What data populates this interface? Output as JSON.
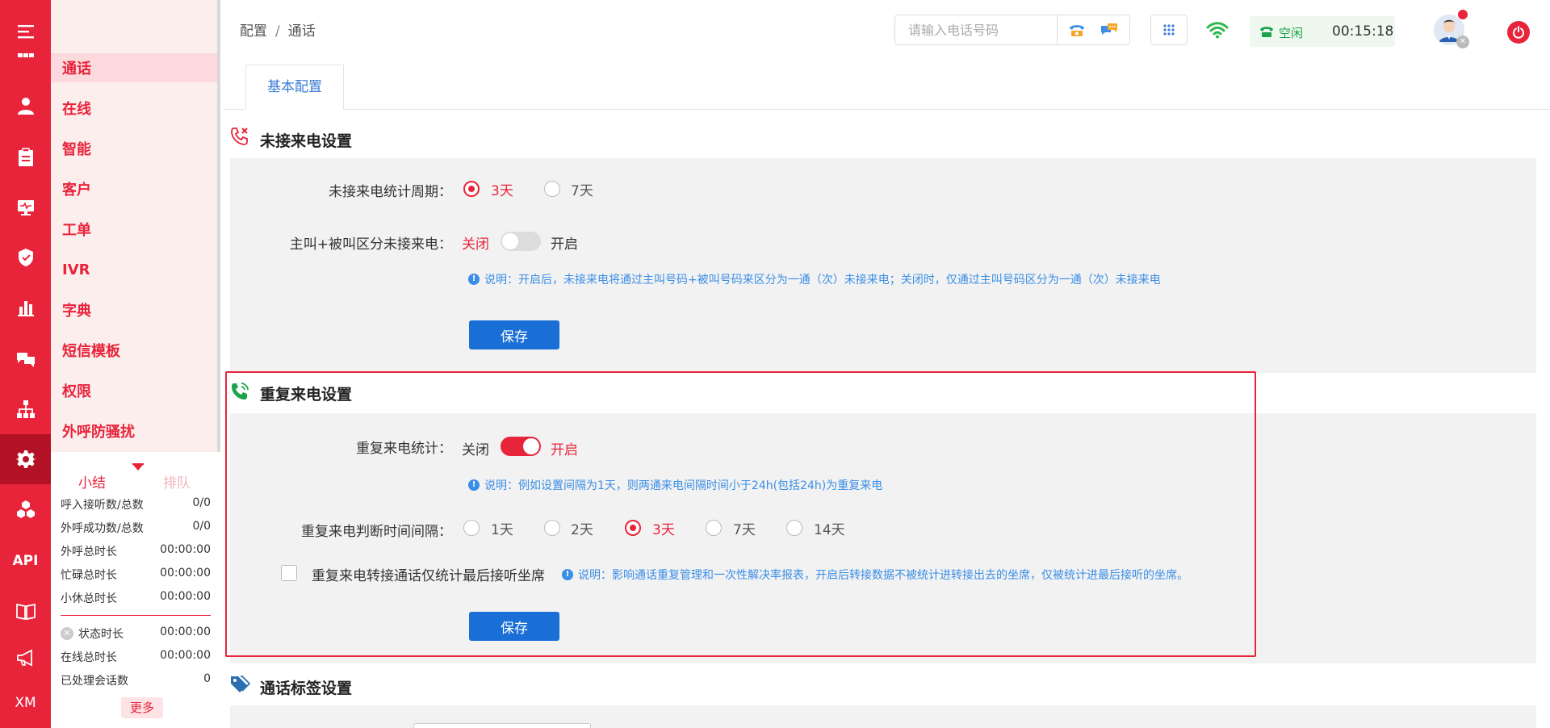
{
  "rail": {
    "items": [
      {
        "icon": "menu-icon"
      },
      {
        "icon": "apps-icon"
      },
      {
        "icon": "user-icon"
      },
      {
        "icon": "clipboard-icon"
      },
      {
        "icon": "monitor-icon"
      },
      {
        "icon": "shield-icon"
      },
      {
        "icon": "chart-icon"
      },
      {
        "icon": "chat-icon"
      },
      {
        "icon": "org-icon"
      },
      {
        "icon": "gear-icon"
      },
      {
        "icon": "cubes-icon"
      },
      {
        "icon": "api-icon",
        "text": "API"
      },
      {
        "icon": "book-icon"
      },
      {
        "icon": "megaphone-icon"
      },
      {
        "icon": "xm-icon",
        "text": "XM"
      }
    ],
    "accent": "#e8243b"
  },
  "submenu": {
    "items": [
      "通话",
      "在线",
      "智能",
      "客户",
      "工单",
      "IVR",
      "字典",
      "短信模板",
      "权限",
      "外呼防骚扰"
    ],
    "active_index": 0
  },
  "summary": {
    "tabs": [
      "小结",
      "排队"
    ],
    "stats": [
      {
        "label": "呼入接听数/总数",
        "value": "0/0"
      },
      {
        "label": "外呼成功数/总数",
        "value": "0/0"
      },
      {
        "label": "外呼总时长",
        "value": "00:00:00"
      },
      {
        "label": "忙碌总时长",
        "value": "00:00:00"
      },
      {
        "label": "小休总时长",
        "value": "00:00:00"
      },
      {
        "label": "状态时长",
        "value": "00:00:00"
      },
      {
        "label": "在线总时长",
        "value": "00:00:00"
      },
      {
        "label": "已处理会话数",
        "value": "0"
      }
    ],
    "more": "更多"
  },
  "header": {
    "breadcrumb": [
      "配置",
      "通话"
    ],
    "breadcrumb_sep": "/",
    "search_placeholder": "请输入电话号码",
    "status": "空闲",
    "timer": "00:15:18"
  },
  "tabs": [
    "基本配置"
  ],
  "missed": {
    "title": "未接来电设置",
    "period_label": "未接来电统计周期：",
    "period_options": [
      "3天",
      "7天"
    ],
    "period_selected": 0,
    "distinguish_label": "主叫+被叫区分未接来电：",
    "off_label": "关闭",
    "on_label": "开启",
    "distinguish_on": false,
    "note": "说明：开启后，未接来电将通过主叫号码+被叫号码来区分为一通（次）未接来电；关闭时，仅通过主叫号码区分为一通（次）未接来电",
    "save": "保存"
  },
  "repeat": {
    "title": "重复来电设置",
    "stat_label": "重复来电统计：",
    "off_label": "关闭",
    "on_label": "开启",
    "stat_on": true,
    "note1": "说明：例如设置间隔为1天，则两通来电间隔时间小于24h(包括24h)为重复来电",
    "interval_label": "重复来电判断时间间隔：",
    "interval_options": [
      "1天",
      "2天",
      "3天",
      "7天",
      "14天"
    ],
    "interval_selected": 2,
    "transfer_label": "重复来电转接通话仅统计最后接听坐席",
    "transfer_checked": false,
    "note2": "说明：影响通话重复管理和一次性解决率报表，开启后转接数据不被统计进转接出去的坐席，仅被统计进最后接听的坐席。",
    "save": "保存"
  },
  "tags": {
    "title": "通话标签设置"
  }
}
